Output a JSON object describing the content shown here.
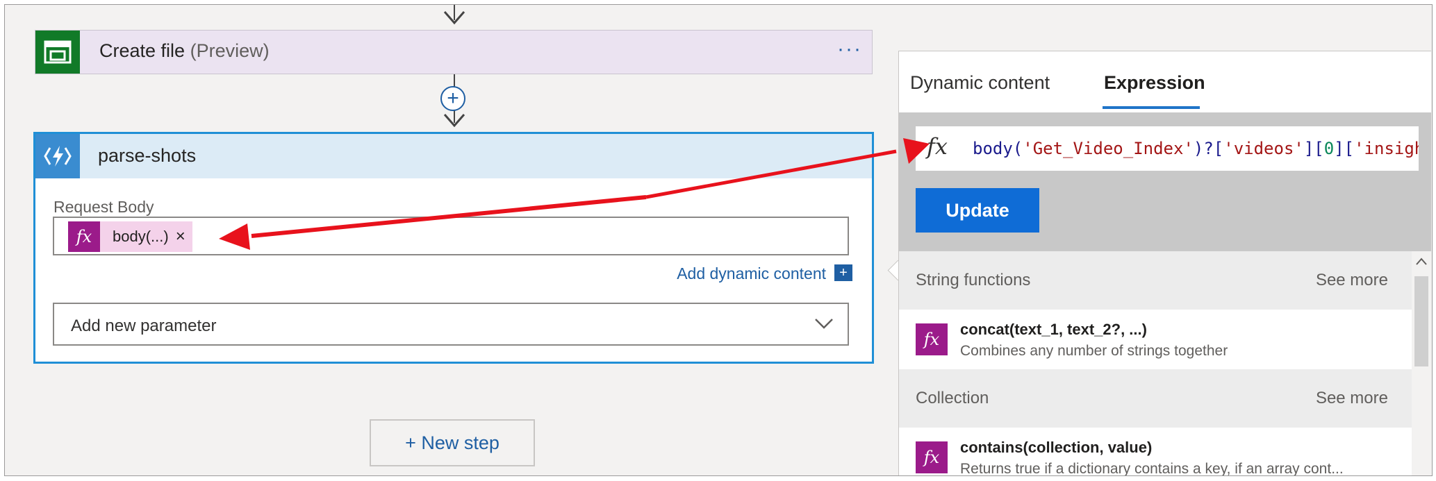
{
  "create_file": {
    "title": "Create file",
    "preview": "(Preview)",
    "more": "···"
  },
  "parse_shots": {
    "title": "parse-shots",
    "request_body_label": "Request Body",
    "token_icon": "fx",
    "token_text": "body(...)",
    "token_remove": "×",
    "add_dynamic_label": "Add dynamic content",
    "add_dynamic_icon": "+",
    "add_param_placeholder": "Add new parameter"
  },
  "connector": {
    "plus": "+"
  },
  "new_step": "+ New step",
  "panel": {
    "tabs": [
      "Dynamic content",
      "Expression"
    ],
    "active_tab": "Expression",
    "expression_icon": "fx",
    "expression_text": {
      "a": "body(",
      "b": "'Get_Video_Index'",
      "c": ")?[",
      "d": "'videos'",
      "e": "][",
      "f": "0",
      "g": "][",
      "h": "'insights'"
    },
    "update_button": "Update",
    "sections": [
      {
        "name": "String functions",
        "more": "See more",
        "item": {
          "icon": "fx",
          "name": "concat(text_1, text_2?, ...)",
          "desc": "Combines any number of strings together"
        }
      },
      {
        "name": "Collection",
        "more": "See more",
        "item": {
          "icon": "fx",
          "name": "contains(collection, value)",
          "desc": "Returns true if a dictionary contains a key, if an array cont..."
        }
      }
    ]
  },
  "colors": {
    "accent": "#1f8fd6",
    "function_icon": "#9b1b8a",
    "arrow": "#e8121c",
    "excel_green": "#117a28"
  }
}
